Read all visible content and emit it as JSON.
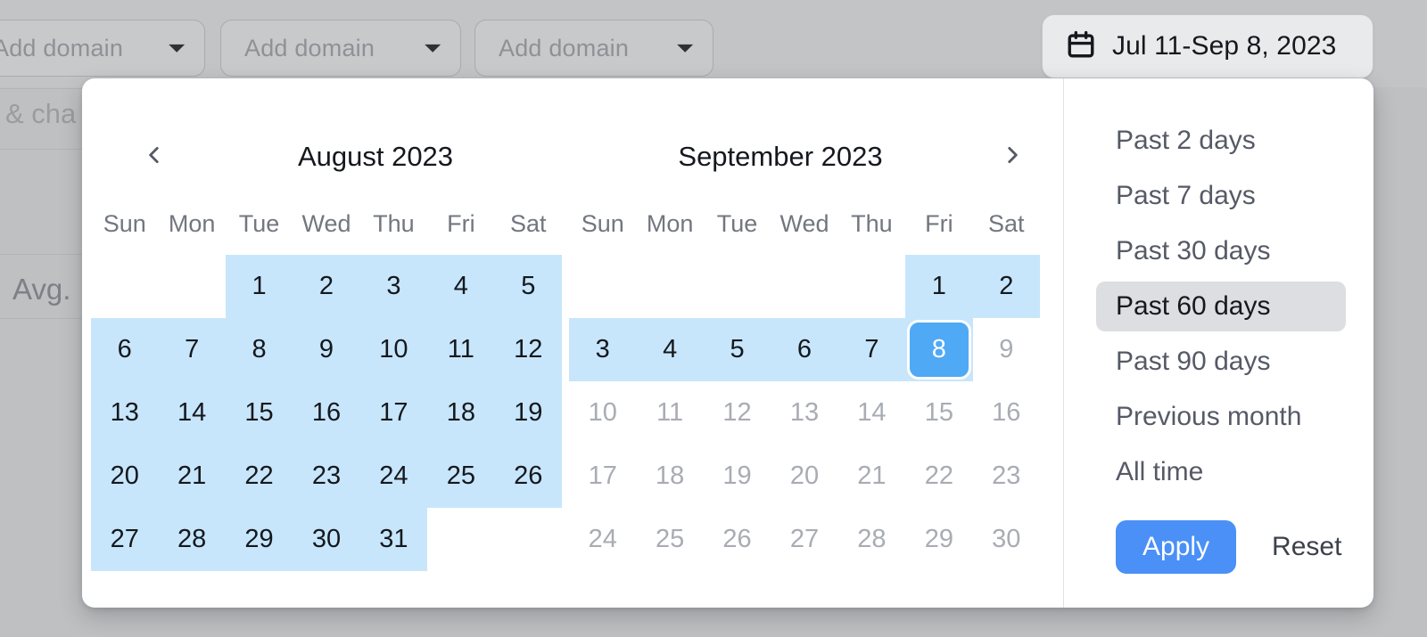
{
  "background": {
    "domain_selectors": [
      {
        "label": "Add domain",
        "icon": "chevron-down-icon"
      },
      {
        "label": "Add domain",
        "icon": "chevron-down-icon"
      },
      {
        "label": "Add domain",
        "icon": "chevron-down-icon"
      }
    ],
    "partial_texts": {
      "chart_label": "& cha",
      "avg_label": "Avg."
    }
  },
  "date_range_button": {
    "icon": "calendar-icon",
    "label": "Jul 11-Sep 8, 2023"
  },
  "picker": {
    "nav": {
      "prev_icon": "chevron-left-icon",
      "next_icon": "chevron-right-icon"
    },
    "weekday_headers": [
      "Sun",
      "Mon",
      "Tue",
      "Wed",
      "Thu",
      "Fri",
      "Sat"
    ],
    "months": [
      {
        "title": "August 2023",
        "lead_blanks": 2,
        "days": [
          {
            "n": "1",
            "state": "in-range"
          },
          {
            "n": "2",
            "state": "in-range"
          },
          {
            "n": "3",
            "state": "in-range"
          },
          {
            "n": "4",
            "state": "in-range"
          },
          {
            "n": "5",
            "state": "in-range"
          },
          {
            "n": "6",
            "state": "in-range"
          },
          {
            "n": "7",
            "state": "in-range"
          },
          {
            "n": "8",
            "state": "in-range"
          },
          {
            "n": "9",
            "state": "in-range"
          },
          {
            "n": "10",
            "state": "in-range"
          },
          {
            "n": "11",
            "state": "in-range"
          },
          {
            "n": "12",
            "state": "in-range"
          },
          {
            "n": "13",
            "state": "in-range"
          },
          {
            "n": "14",
            "state": "in-range"
          },
          {
            "n": "15",
            "state": "in-range"
          },
          {
            "n": "16",
            "state": "in-range"
          },
          {
            "n": "17",
            "state": "in-range"
          },
          {
            "n": "18",
            "state": "in-range"
          },
          {
            "n": "19",
            "state": "in-range"
          },
          {
            "n": "20",
            "state": "in-range"
          },
          {
            "n": "21",
            "state": "in-range"
          },
          {
            "n": "22",
            "state": "in-range"
          },
          {
            "n": "23",
            "state": "in-range"
          },
          {
            "n": "24",
            "state": "in-range"
          },
          {
            "n": "25",
            "state": "in-range"
          },
          {
            "n": "26",
            "state": "in-range"
          },
          {
            "n": "27",
            "state": "in-range"
          },
          {
            "n": "28",
            "state": "in-range"
          },
          {
            "n": "29",
            "state": "in-range"
          },
          {
            "n": "30",
            "state": "in-range"
          },
          {
            "n": "31",
            "state": "in-range"
          }
        ]
      },
      {
        "title": "September 2023",
        "lead_blanks": 5,
        "days": [
          {
            "n": "1",
            "state": "in-range"
          },
          {
            "n": "2",
            "state": "in-range"
          },
          {
            "n": "3",
            "state": "in-range"
          },
          {
            "n": "4",
            "state": "in-range"
          },
          {
            "n": "5",
            "state": "in-range"
          },
          {
            "n": "6",
            "state": "in-range"
          },
          {
            "n": "7",
            "state": "in-range"
          },
          {
            "n": "8",
            "state": "selected"
          },
          {
            "n": "9",
            "state": "muted"
          },
          {
            "n": "10",
            "state": "muted"
          },
          {
            "n": "11",
            "state": "muted"
          },
          {
            "n": "12",
            "state": "muted"
          },
          {
            "n": "13",
            "state": "muted"
          },
          {
            "n": "14",
            "state": "muted"
          },
          {
            "n": "15",
            "state": "muted"
          },
          {
            "n": "16",
            "state": "muted"
          },
          {
            "n": "17",
            "state": "muted"
          },
          {
            "n": "18",
            "state": "muted"
          },
          {
            "n": "19",
            "state": "muted"
          },
          {
            "n": "20",
            "state": "muted"
          },
          {
            "n": "21",
            "state": "muted"
          },
          {
            "n": "22",
            "state": "muted"
          },
          {
            "n": "23",
            "state": "muted"
          },
          {
            "n": "24",
            "state": "muted"
          },
          {
            "n": "25",
            "state": "muted"
          },
          {
            "n": "26",
            "state": "muted"
          },
          {
            "n": "27",
            "state": "muted"
          },
          {
            "n": "28",
            "state": "muted"
          },
          {
            "n": "29",
            "state": "muted"
          },
          {
            "n": "30",
            "state": "muted"
          }
        ]
      }
    ],
    "presets": [
      {
        "label": "Past 2 days",
        "active": false
      },
      {
        "label": "Past 7 days",
        "active": false
      },
      {
        "label": "Past 30 days",
        "active": false
      },
      {
        "label": "Past 60 days",
        "active": true
      },
      {
        "label": "Past 90 days",
        "active": false
      },
      {
        "label": "Previous month",
        "active": false
      },
      {
        "label": "All time",
        "active": false
      }
    ],
    "actions": {
      "apply_label": "Apply",
      "reset_label": "Reset"
    }
  },
  "colors": {
    "accent_blue": "#4a90f7",
    "selected_day": "#4fa9f5",
    "range_fill": "#c7e6fb",
    "preset_active_bg": "#dcdee1",
    "page_bg": "#bfc0c2"
  }
}
